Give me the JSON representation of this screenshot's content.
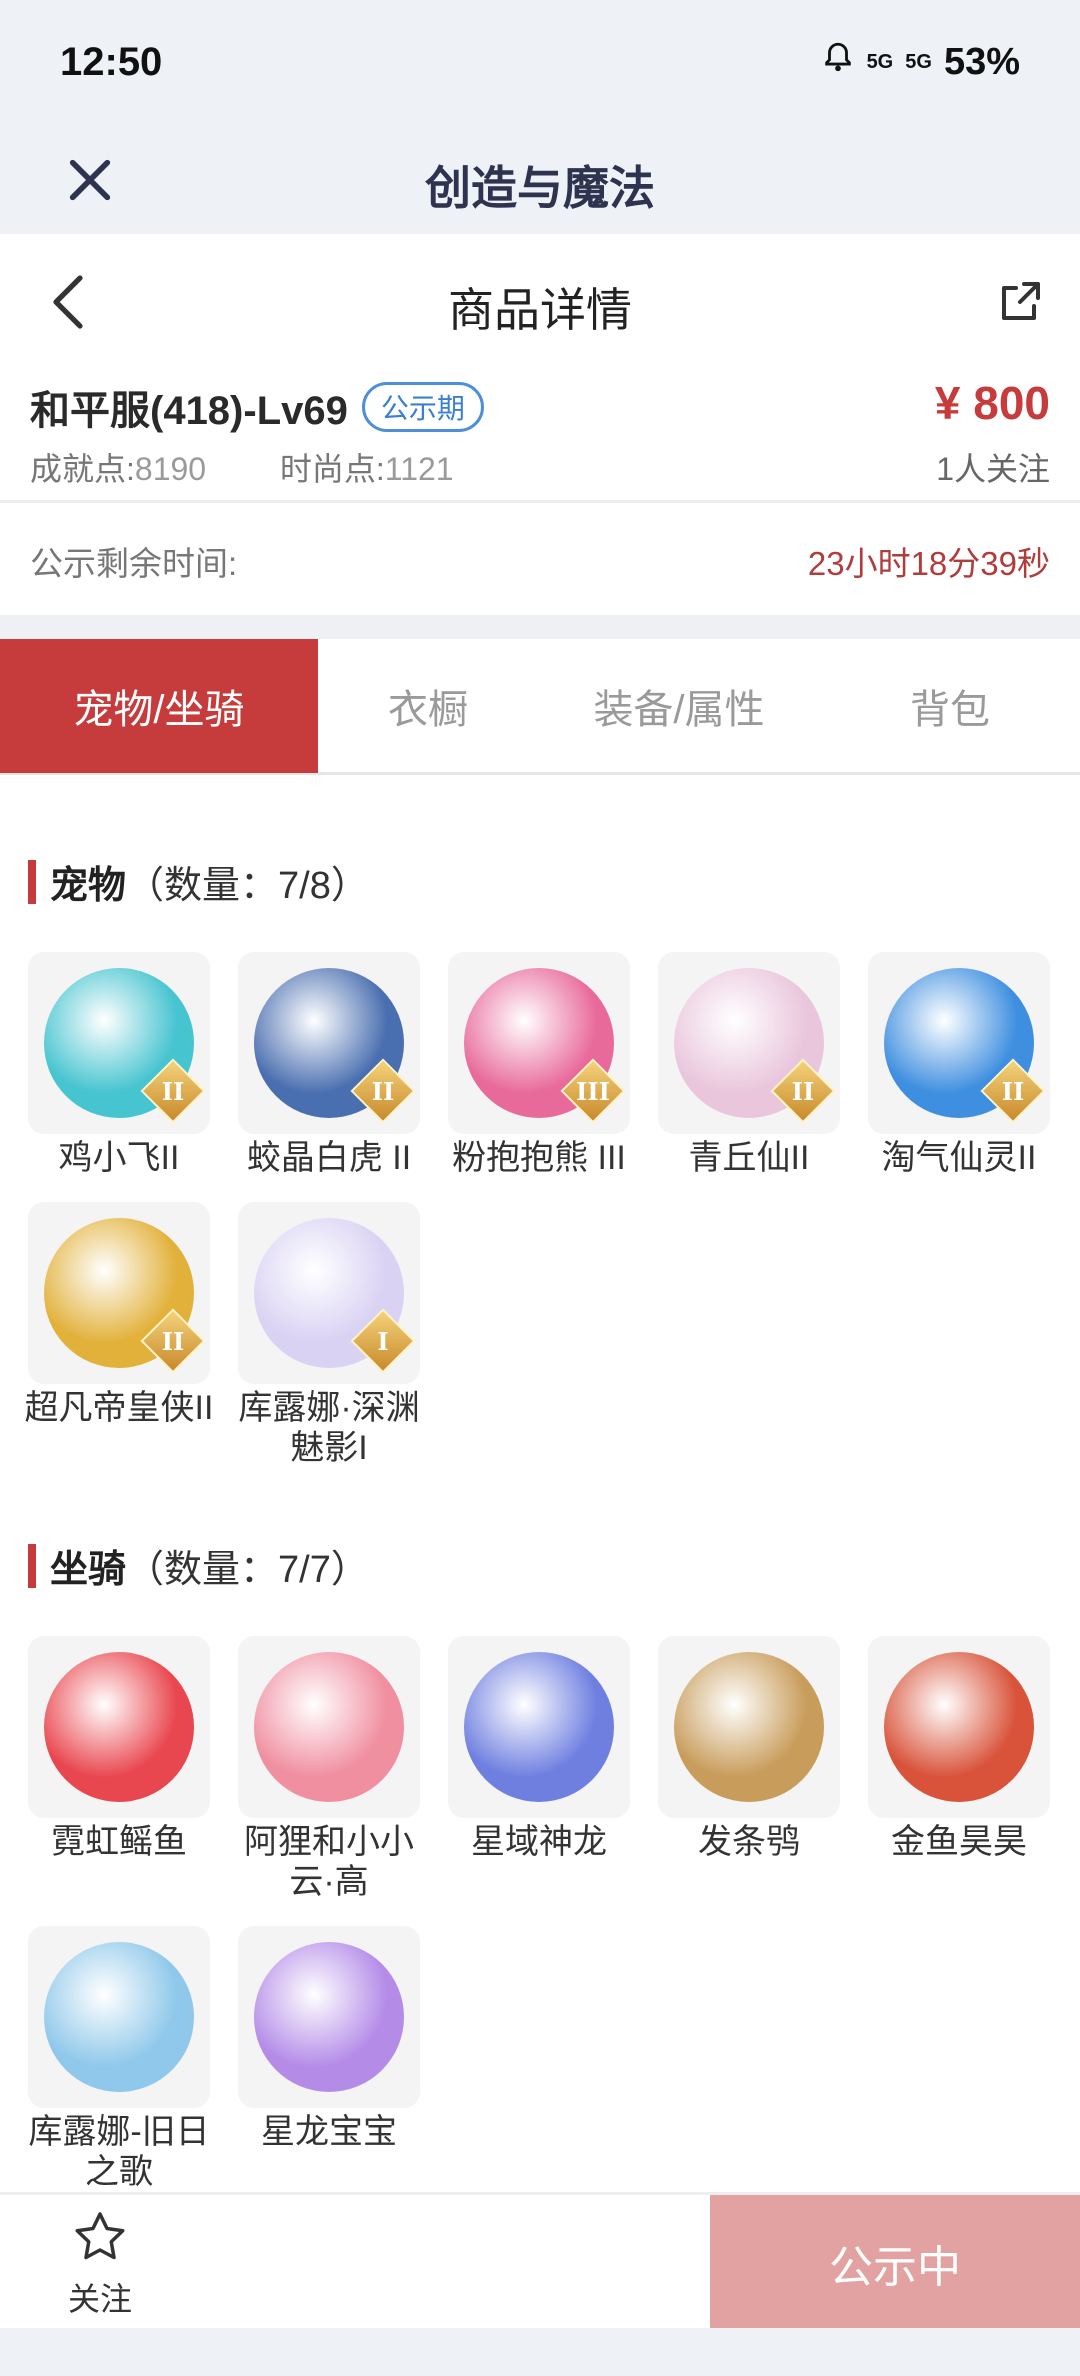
{
  "status": {
    "time": "12:50",
    "battery": "53%",
    "signal1": "5G",
    "signal2": "5G"
  },
  "app": {
    "title": "创造与魔法"
  },
  "nav": {
    "title": "商品详情"
  },
  "product": {
    "name": "和平服(418)-Lv69",
    "badge": "公示期",
    "achievement_label": "成就点:",
    "achievement_value": "8190",
    "fashion_label": "时尚点:",
    "fashion_value": "1121",
    "price": "¥ 800",
    "followers": "1人关注"
  },
  "remain": {
    "label": "公示剩余时间:",
    "value": "23小时18分39秒"
  },
  "tabs": [
    {
      "label": "宠物/坐骑"
    },
    {
      "label": "衣橱"
    },
    {
      "label": "装备/属性"
    },
    {
      "label": "背包"
    }
  ],
  "pets": {
    "title": "宠物",
    "count": "（数量：7/8）",
    "items": [
      {
        "label": "鸡小飞II",
        "rank": "II",
        "color": "#46c4d0"
      },
      {
        "label": "蛟晶白虎 II",
        "rank": "II",
        "color": "#4a6fb0"
      },
      {
        "label": "粉抱抱熊 III",
        "rank": "III",
        "color": "#e86a9a"
      },
      {
        "label": "青丘仙II",
        "rank": "II",
        "color": "#e9c6dc"
      },
      {
        "label": "淘气仙灵II",
        "rank": "II",
        "color": "#3f8fe0"
      },
      {
        "label": "超凡帝皇侠II",
        "rank": "II",
        "color": "#e2b13a"
      },
      {
        "label": "库露娜·深渊魅影I",
        "rank": "I",
        "color": "#d9d2f3"
      }
    ]
  },
  "mounts": {
    "title": "坐骑",
    "count": "（数量：7/7）",
    "items": [
      {
        "label": "霓虹鳐鱼",
        "color": "#e9474f"
      },
      {
        "label": "阿狸和小小云·高",
        "color": "#f08fa0"
      },
      {
        "label": "星域神龙",
        "color": "#6f7fe0"
      },
      {
        "label": "发条鸮",
        "color": "#c89c5a"
      },
      {
        "label": "金鱼昊昊",
        "color": "#d8533a"
      },
      {
        "label": "库露娜-旧日之歌",
        "color": "#8fc8ea"
      },
      {
        "label": "星龙宝宝",
        "color": "#b48ce8"
      }
    ]
  },
  "bottom": {
    "follow_label": "关注",
    "action_label": "公示中"
  }
}
